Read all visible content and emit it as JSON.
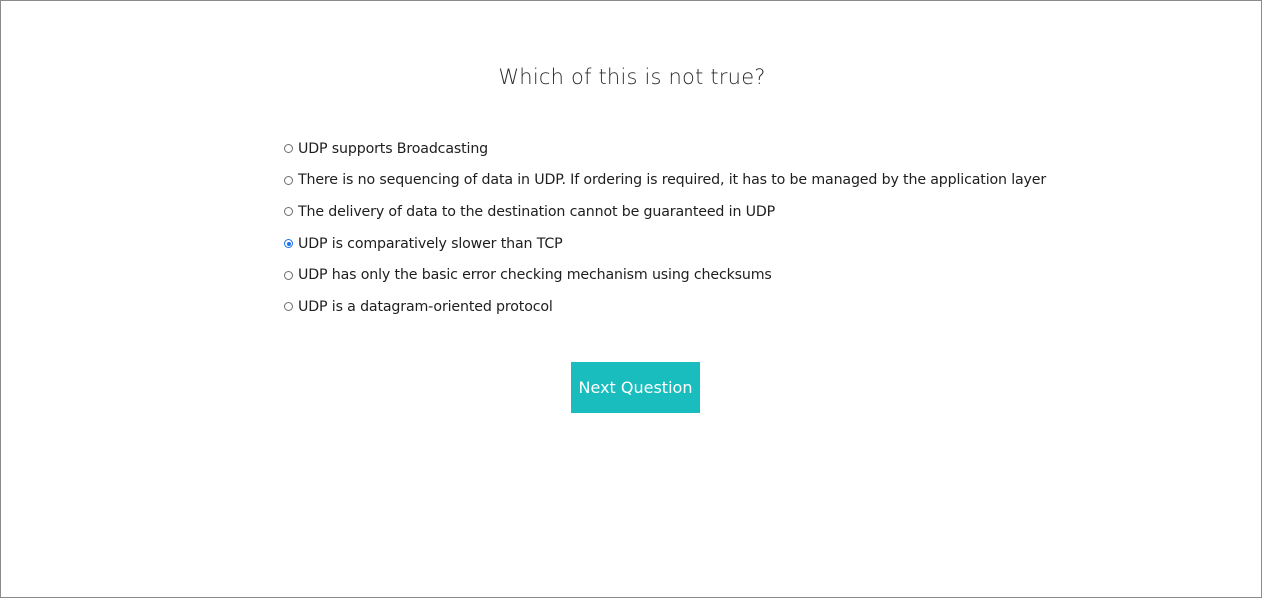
{
  "quiz": {
    "question": "Which of this is not true?",
    "options": [
      {
        "label": "UDP supports Broadcasting",
        "selected": false
      },
      {
        "label": "There is no sequencing of data in UDP. If ordering is required, it has to be managed by the application layer",
        "selected": false
      },
      {
        "label": "The delivery of data to the destination cannot be guaranteed in UDP",
        "selected": false
      },
      {
        "label": "UDP is comparatively slower than TCP",
        "selected": true
      },
      {
        "label": "UDP has only the basic error checking mechanism using checksums",
        "selected": false
      },
      {
        "label": "UDP is a datagram-oriented protocol",
        "selected": false
      }
    ],
    "next_button_label": "Next Question"
  },
  "colors": {
    "accent": "#19bdbd",
    "radio_selected": "#1a73e8",
    "text": "#1e1e1e"
  }
}
